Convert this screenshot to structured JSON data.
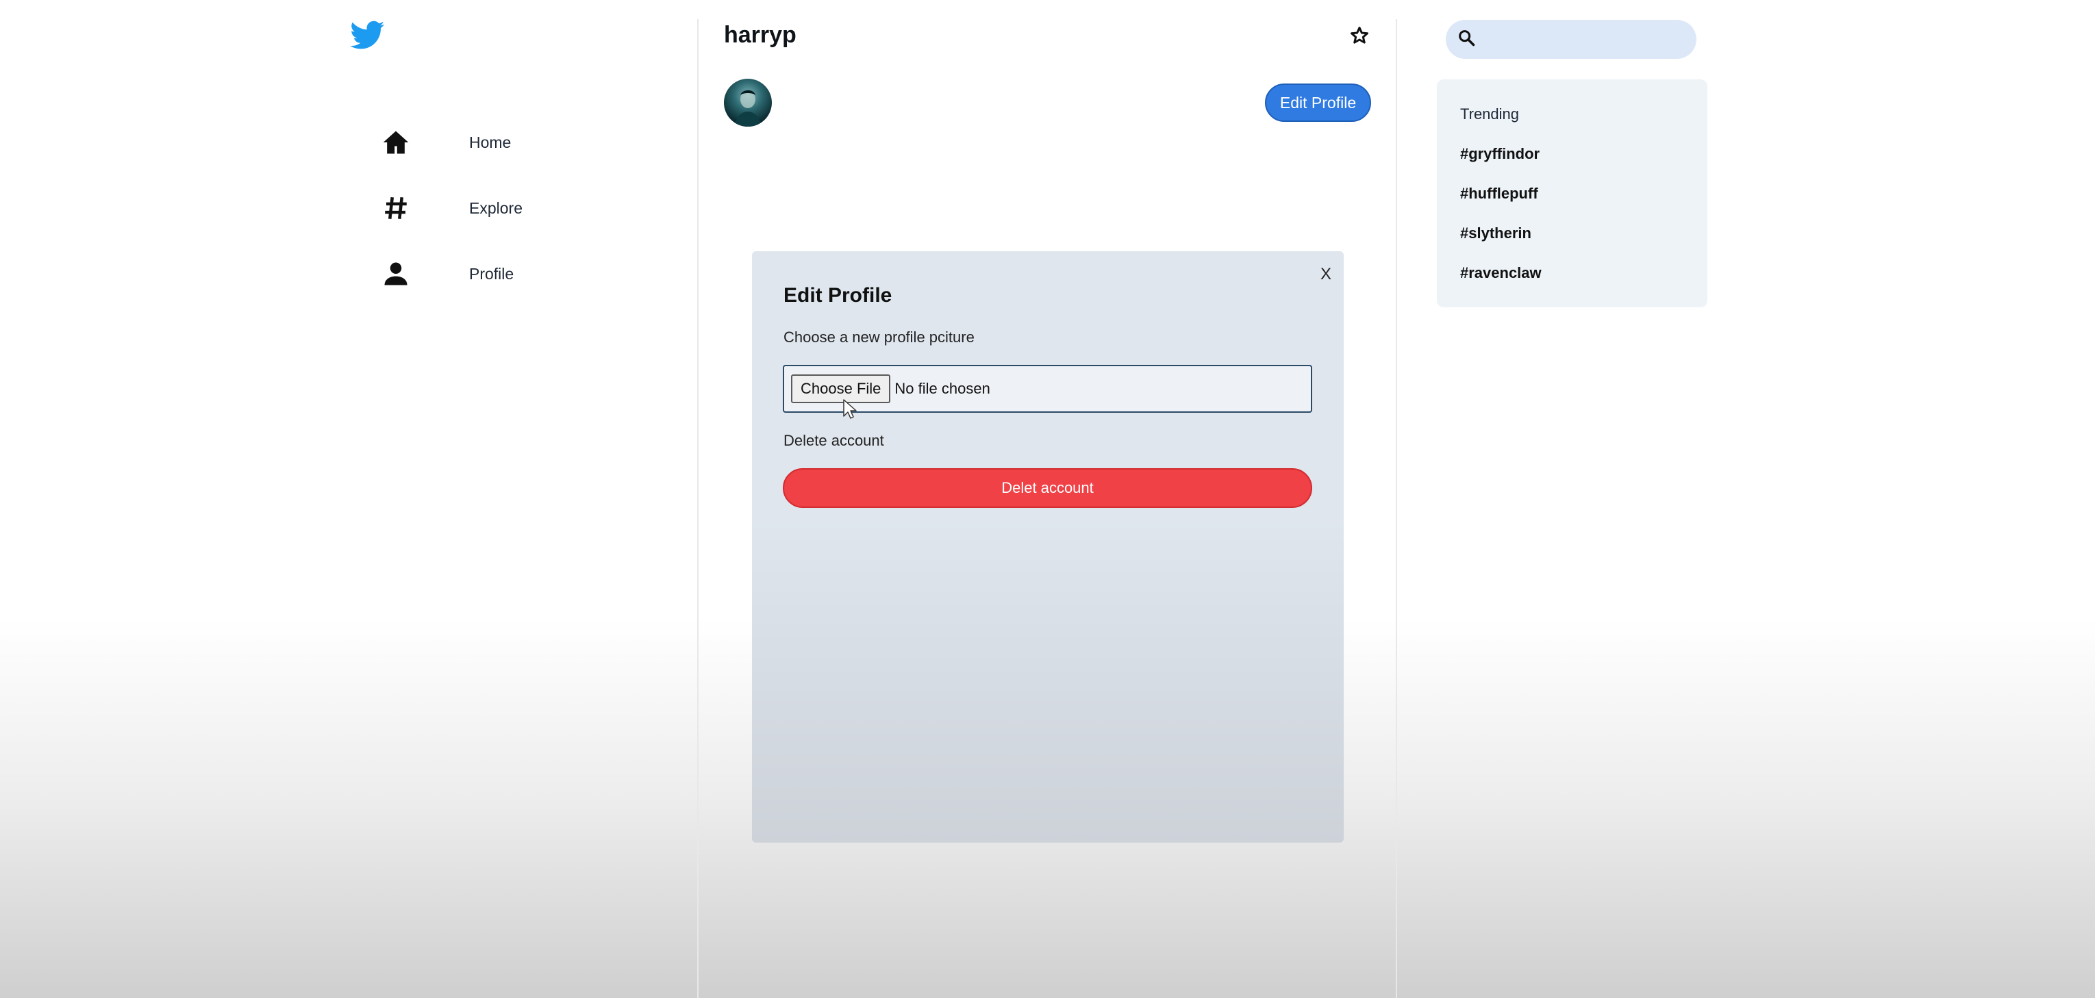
{
  "colors": {
    "brand": "#1d9bf0",
    "primary_button": "#2f7be2",
    "danger_button": "#ef4146",
    "search_bg": "#dce8f8",
    "trending_bg": "#eef3f8",
    "modal_bg": "#dfe6ee"
  },
  "sidebar": {
    "logo_icon": "twitter-bird-icon",
    "items": [
      {
        "label": "Home",
        "icon": "home-icon"
      },
      {
        "label": "Explore",
        "icon": "hashtag-icon"
      },
      {
        "label": "Profile",
        "icon": "person-icon"
      }
    ]
  },
  "profile": {
    "username": "harryp",
    "star_icon": "star-icon",
    "edit_button_label": "Edit Profile"
  },
  "modal": {
    "title": "Edit Profile",
    "close_label": "X",
    "picture_label": "Choose a new profile pciture",
    "file_button_label": "Choose File",
    "file_status": "No file chosen",
    "delete_label": "Delete account",
    "delete_button_label": "Delet account"
  },
  "search": {
    "icon": "search-icon",
    "value": ""
  },
  "trending": {
    "title": "Trending",
    "tags": [
      "#gryffindor",
      "#hufflepuff",
      "#slytherin",
      "#ravenclaw"
    ]
  }
}
